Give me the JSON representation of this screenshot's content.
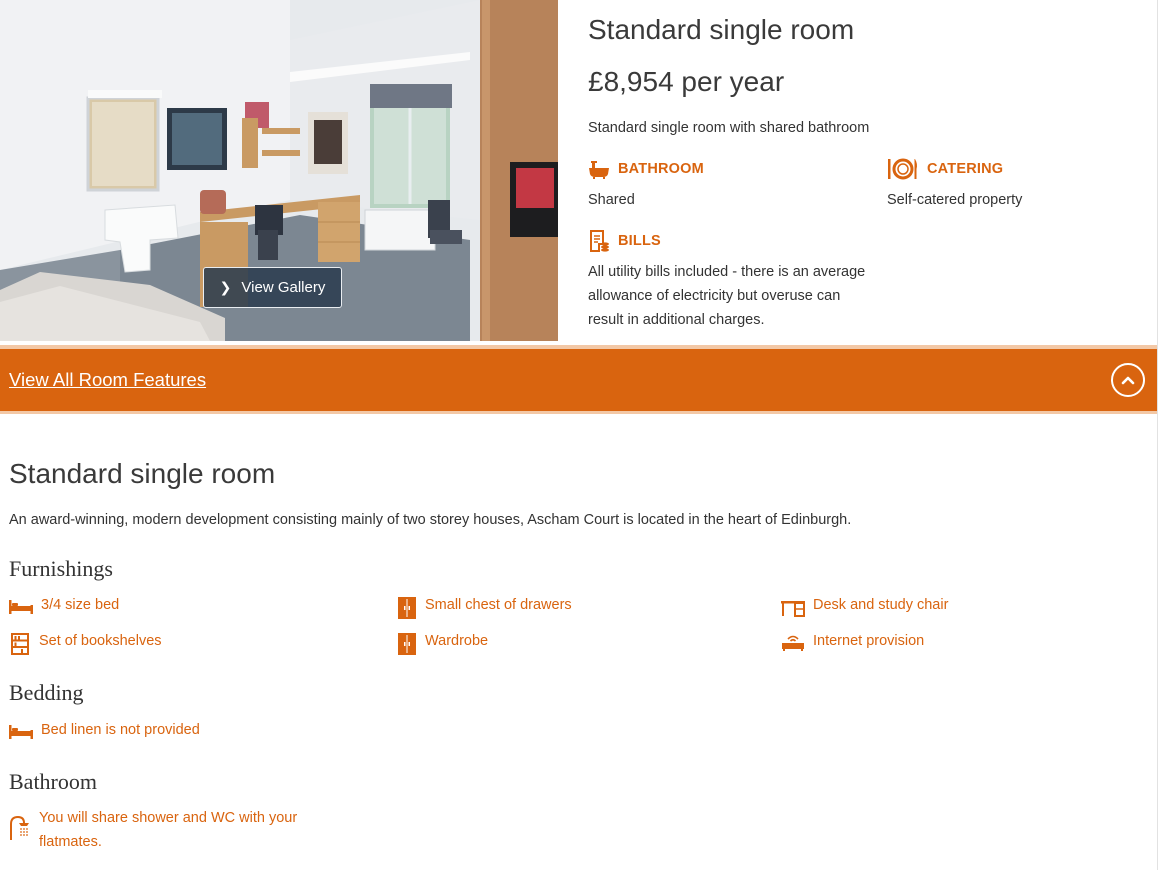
{
  "gallery": {
    "button_label": "View Gallery"
  },
  "room": {
    "title": "Standard single room",
    "price": "£8,954 per year",
    "short_description": "Standard single room with shared bathroom"
  },
  "attributes": {
    "bathroom": {
      "label": "BATHROOM",
      "value": "Shared",
      "icon": "bath-icon"
    },
    "catering": {
      "label": "CATERING",
      "value": "Self-catered property",
      "icon": "plate-cutlery-icon"
    },
    "bills": {
      "label": "BILLS",
      "value": "All utility bills included - there is an average allowance of electricity but overuse can result in additional charges.",
      "icon": "bill-icon"
    }
  },
  "features_bar": {
    "link_label": "View All Room Features",
    "toggle_icon": "chevron-up-circle-icon"
  },
  "details": {
    "title": "Standard single room",
    "description": "An award-winning, modern development consisting mainly of two storey houses, Ascham Court is located in the heart of Edinburgh.",
    "furnishings": {
      "heading": "Furnishings",
      "items": [
        {
          "label": "3/4 size bed",
          "icon": "bed-icon"
        },
        {
          "label": "Small chest of drawers",
          "icon": "drawers-icon"
        },
        {
          "label": "Desk and study chair",
          "icon": "desk-icon"
        },
        {
          "label": "Set of bookshelves",
          "icon": "bookshelf-icon"
        },
        {
          "label": "Wardrobe",
          "icon": "wardrobe-icon"
        },
        {
          "label": "Internet provision",
          "icon": "router-icon"
        }
      ]
    },
    "bedding": {
      "heading": "Bedding",
      "items": [
        {
          "label": "Bed linen is not provided",
          "icon": "bed-icon"
        }
      ]
    },
    "bathroom": {
      "heading": "Bathroom",
      "items": [
        {
          "label": "You will share shower and WC with your flatmates.",
          "icon": "shower-icon"
        }
      ]
    }
  },
  "colors": {
    "accent": "#d9640f",
    "accent_light": "#f3c8a6",
    "text": "#333333"
  }
}
